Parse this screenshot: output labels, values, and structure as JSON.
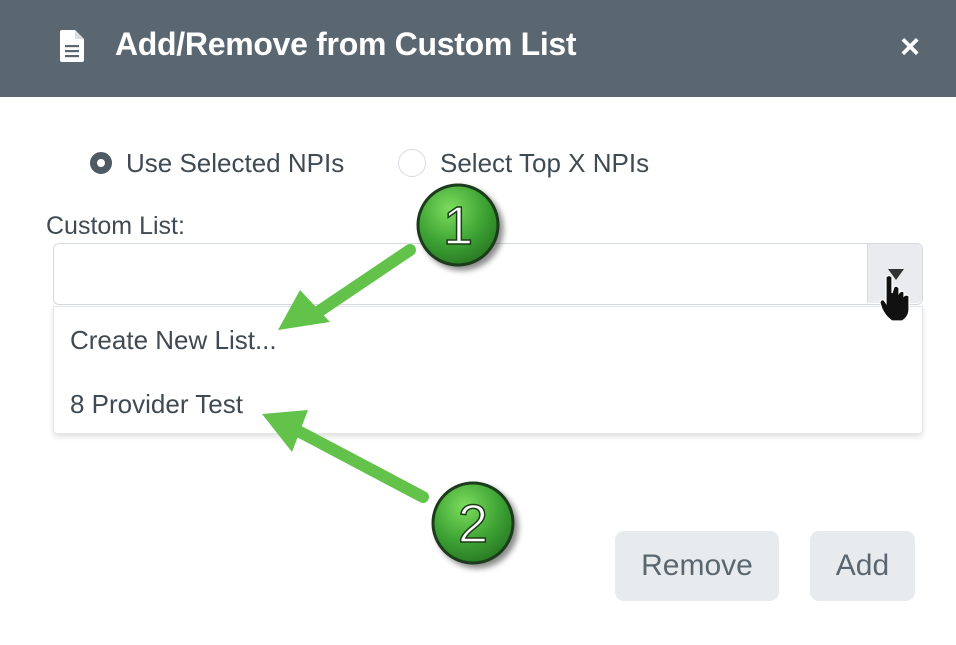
{
  "dialog": {
    "title": "Add/Remove from Custom List",
    "title_icon": "document-icon",
    "close_label": "×"
  },
  "selection_mode": {
    "options": [
      {
        "label": "Use Selected NPIs",
        "checked": true
      },
      {
        "label": "Select Top X NPIs",
        "checked": false
      }
    ]
  },
  "custom_list": {
    "label": "Custom List:",
    "value": "",
    "options": [
      "Create New List...",
      "8 Provider Test"
    ]
  },
  "actions": {
    "remove_label": "Remove",
    "add_label": "Add"
  },
  "annotations": {
    "step1": "1",
    "step2": "2"
  },
  "colors": {
    "header_bg": "#5b6770",
    "callout_green": "#3fa535",
    "arrow_green": "#62c24a"
  }
}
